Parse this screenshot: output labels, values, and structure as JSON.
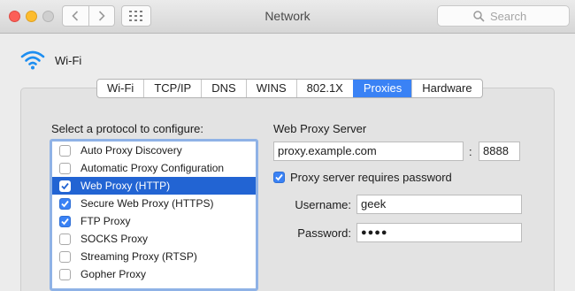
{
  "window": {
    "title": "Network"
  },
  "toolbar": {
    "search_placeholder": "Search",
    "back_icon": "chevron-left-icon",
    "forward_icon": "chevron-right-icon",
    "show_all_icon": "grid-icon"
  },
  "interface": {
    "name": "Wi-Fi",
    "icon": "wifi-icon"
  },
  "tabs": [
    {
      "label": "Wi-Fi",
      "active": false
    },
    {
      "label": "TCP/IP",
      "active": false
    },
    {
      "label": "DNS",
      "active": false
    },
    {
      "label": "WINS",
      "active": false
    },
    {
      "label": "802.1X",
      "active": false
    },
    {
      "label": "Proxies",
      "active": true
    },
    {
      "label": "Hardware",
      "active": false
    }
  ],
  "protocols": {
    "label": "Select a protocol to configure:",
    "items": [
      {
        "label": "Auto Proxy Discovery",
        "checked": false,
        "selected": false
      },
      {
        "label": "Automatic Proxy Configuration",
        "checked": false,
        "selected": false
      },
      {
        "label": "Web Proxy (HTTP)",
        "checked": true,
        "selected": true
      },
      {
        "label": "Secure Web Proxy (HTTPS)",
        "checked": true,
        "selected": false
      },
      {
        "label": "FTP Proxy",
        "checked": true,
        "selected": false
      },
      {
        "label": "SOCKS Proxy",
        "checked": false,
        "selected": false
      },
      {
        "label": "Streaming Proxy (RTSP)",
        "checked": false,
        "selected": false
      },
      {
        "label": "Gopher Proxy",
        "checked": false,
        "selected": false
      }
    ]
  },
  "server": {
    "title": "Web Proxy Server",
    "host": "proxy.example.com",
    "separator": ":",
    "port": "8888",
    "requires_password_label": "Proxy server requires password",
    "requires_password": true,
    "username_label": "Username:",
    "username": "geek",
    "password_label": "Password:",
    "password_masked": "●●●●"
  },
  "colors": {
    "accent": "#3a82f5",
    "selection": "#2264d3"
  }
}
